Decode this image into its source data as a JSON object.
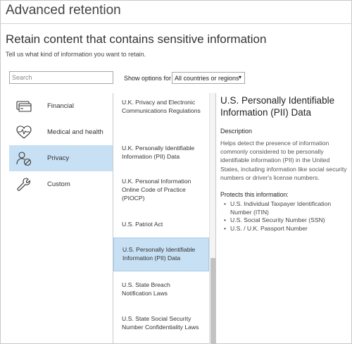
{
  "window": {
    "title": "Advanced retention"
  },
  "page": {
    "heading": "Retain content that contains sensitive information",
    "subheading": "Tell us what kind of information you want to retain."
  },
  "search": {
    "placeholder": "Search",
    "value": ""
  },
  "filter": {
    "label": "Show options for",
    "selected": "All countries or regions"
  },
  "categories": [
    {
      "label": "Financial",
      "icon": "credit-card-icon",
      "selected": false
    },
    {
      "label": "Medical and health",
      "icon": "heart-pulse-icon",
      "selected": false
    },
    {
      "label": "Privacy",
      "icon": "user-block-icon",
      "selected": true
    },
    {
      "label": "Custom",
      "icon": "wrench-icon",
      "selected": false
    }
  ],
  "regulations": [
    {
      "label": "U.K. Privacy and Electronic Communications Regulations",
      "selected": false
    },
    {
      "label": "U.K. Personally Identifiable Information (PII) Data",
      "selected": false
    },
    {
      "label": "U.K. Personal Information Online Code of Practice (PIOCP)",
      "selected": false
    },
    {
      "label": "U.S. Patriot Act",
      "selected": false
    },
    {
      "label": "U.S. Personally Identifiable Information (PII) Data",
      "selected": true
    },
    {
      "label": "U.S. State Breach Notification Laws",
      "selected": false
    },
    {
      "label": "U.S. State Social Security Number Confidentiality Laws",
      "selected": false
    }
  ],
  "detail": {
    "title": "U.S. Personally Identifiable Information (PII) Data",
    "description_heading": "Description",
    "description": "Helps detect the presence of information commonly considered to be personally identifiable information (PII) in the United States, including information like social security numbers or driver's license numbers.",
    "protects_heading": "Protects this information:",
    "protects": [
      "U.S. Individual Taxpayer Identification Number (ITIN)",
      "U.S. Social Security Number (SSN)",
      "U.S. / U.K. Passport Number"
    ]
  },
  "colors": {
    "selection": "#c7e0f4",
    "border": "#c8c8c8",
    "text": "#333333"
  }
}
